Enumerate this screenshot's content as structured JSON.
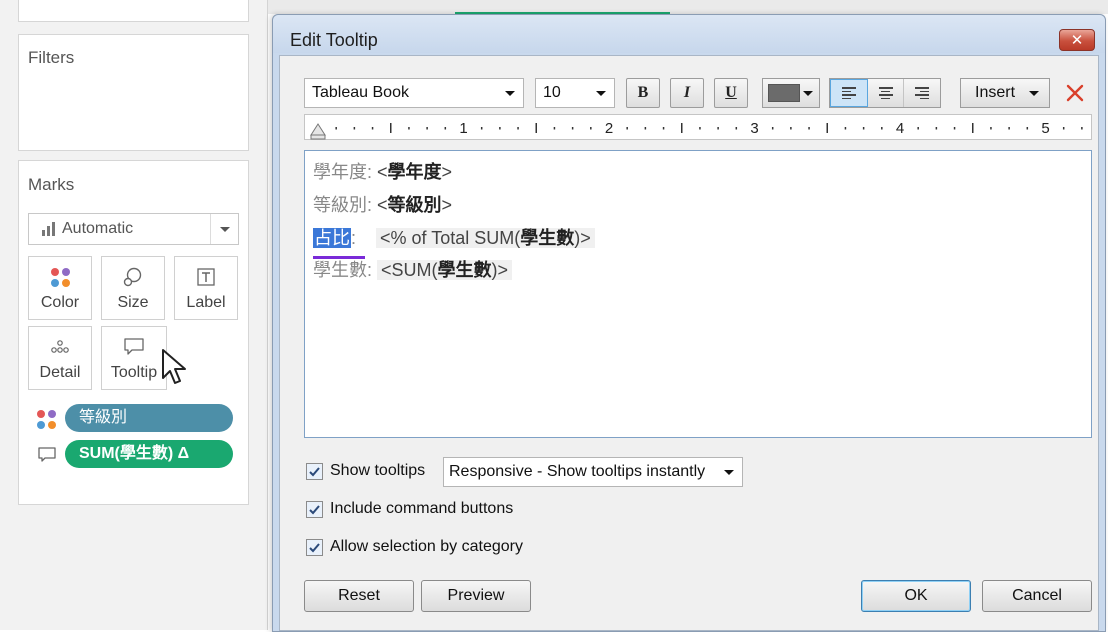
{
  "left_pane": {
    "filters_title": "Filters",
    "marks_title": "Marks",
    "mark_type": "Automatic",
    "buttons": {
      "color": "Color",
      "size": "Size",
      "label": "Label",
      "detail": "Detail",
      "tooltip": "Tooltip"
    },
    "pills": [
      {
        "label": "等級別",
        "color": "#4d8fa8"
      },
      {
        "label": "SUM(學生數) Δ",
        "color": "#1aa870"
      }
    ]
  },
  "dialog": {
    "title": "Edit Tooltip",
    "toolbar": {
      "font": "Tableau Book",
      "size": "10",
      "bold": "B",
      "italic": "I",
      "underline": "U",
      "text_color": "#6b6b6b",
      "insert": "Insert"
    },
    "ruler_labels": [
      "1",
      "2",
      "3",
      "4",
      "5"
    ],
    "editor_lines": [
      {
        "label": "學年度:",
        "field_open": "<",
        "field_name": "學年度",
        "field_close": ">"
      },
      {
        "label": "等級別:",
        "field_open": "<",
        "field_name": "等級別",
        "field_close": ">"
      },
      {
        "label_selected": "占比",
        "label_rest": ":",
        "field_prefix": "<% of Total SUM(",
        "field_name": "學生數",
        "field_suffix": ")>"
      },
      {
        "label": "學生數:",
        "field_prefix": "<SUM(",
        "field_name": "學生數",
        "field_suffix": ")>"
      }
    ],
    "options": {
      "show_tooltips": "Show tooltips",
      "show_tooltips_mode": "Responsive - Show tooltips instantly",
      "include_command_buttons": "Include command buttons",
      "allow_selection": "Allow selection by category"
    },
    "buttons": {
      "reset": "Reset",
      "preview": "Preview",
      "ok": "OK",
      "cancel": "Cancel"
    }
  }
}
